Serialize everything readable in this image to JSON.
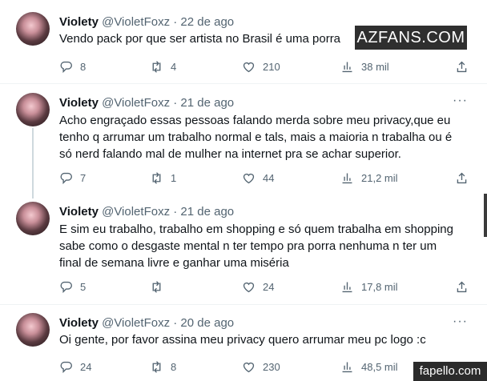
{
  "tweets": [
    {
      "name": "Violety",
      "handle": "@VioletFoxz",
      "dot": "·",
      "date": "22 de ago",
      "lines": [
        "Vendo pack por que ser artista no Brasil é uma porra"
      ],
      "replies": "8",
      "retweets": "4",
      "likes": "210",
      "views": "38 mil"
    },
    {
      "name": "Violety",
      "handle": "@VioletFoxz",
      "dot": "·",
      "date": "21 de ago",
      "lines": [
        "Acho engraçado essas  pessoas falando merda sobre meu privacy,que eu",
        "tenho q arrumar um trabalho  normal e tals, mais a maioria n trabalha ou é",
        "só nerd falando mal de mulher na internet pra se achar superior."
      ],
      "replies": "7",
      "retweets": "1",
      "likes": "44",
      "views": "21,2 mil"
    },
    {
      "name": "Violety",
      "handle": "@VioletFoxz",
      "dot": "·",
      "date": "21 de ago",
      "lines": [
        "E sim eu trabalho, trabalho em shopping e só quem trabalha em shopping",
        "sabe como o desgaste mental n ter tempo pra porra nenhuma n ter um",
        "final de semana livre e ganhar uma miséria"
      ],
      "replies": "5",
      "retweets": "",
      "likes": "24",
      "views": "17,8 mil"
    },
    {
      "name": "Violety",
      "handle": "@VioletFoxz",
      "dot": "·",
      "date": "20 de ago",
      "lines": [
        "Oi gente, por favor assina meu privacy quero arrumar meu pc logo :c"
      ],
      "replies": "24",
      "retweets": "8",
      "likes": "230",
      "views": "48,5 mil"
    }
  ],
  "more_glyph": "···",
  "watermarks": {
    "azfans": "AZFANS.COM",
    "fapello": "fapello.com"
  },
  "icons": [
    "reply-icon",
    "retweet-icon",
    "like-icon",
    "views-icon",
    "share-icon",
    "more-icon"
  ]
}
